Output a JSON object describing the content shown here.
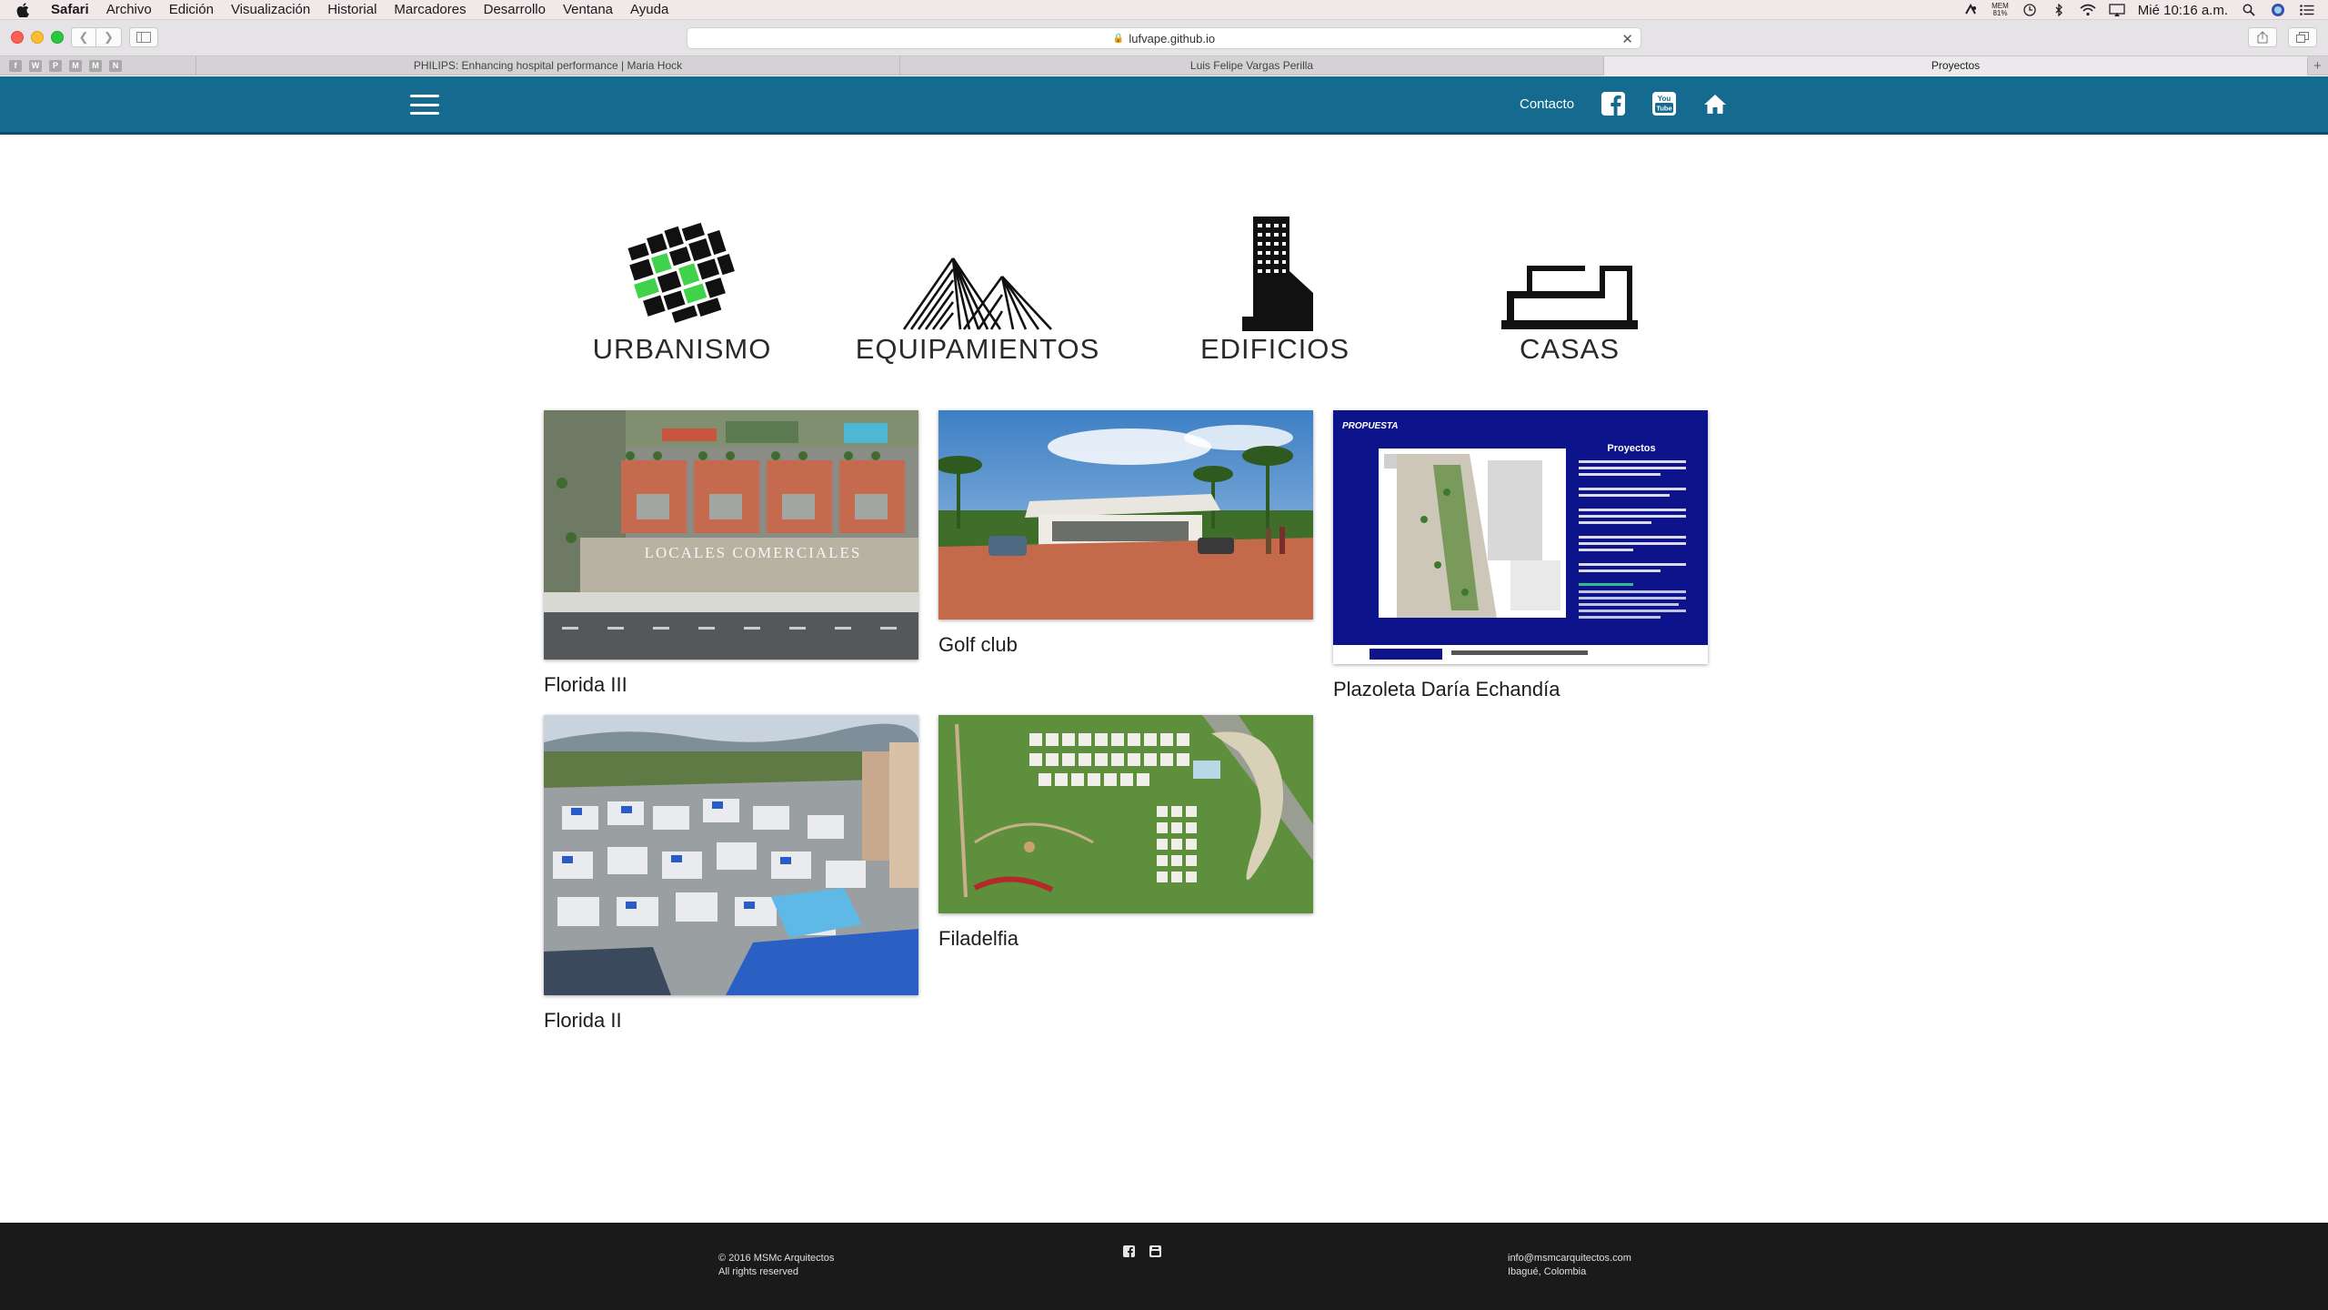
{
  "menubar": {
    "app": "Safari",
    "items": [
      "Archivo",
      "Edición",
      "Visualización",
      "Historial",
      "Marcadores",
      "Desarrollo",
      "Ventana",
      "Ayuda"
    ],
    "battery_label": "MEM",
    "battery_value": "81%",
    "clock": "Mié 10:16 a.m."
  },
  "browser": {
    "url": "lufvape.github.io",
    "pinned_tabs": [
      "f",
      "W",
      "P",
      "M",
      "M",
      "N"
    ],
    "tabs": [
      {
        "title": "PHILIPS: Enhancing hospital performance | Maria Hock"
      },
      {
        "title": "Luis Felipe Vargas Perilla"
      },
      {
        "title": "Proyectos"
      }
    ],
    "new_tab": "+"
  },
  "header": {
    "contact": "Contacto",
    "icons": [
      "facebook-icon",
      "youtube-icon",
      "home-icon"
    ],
    "accent_color": "#156b8f"
  },
  "categories": [
    {
      "label": "URBANISMO"
    },
    {
      "label": "EQUIPAMIENTOS"
    },
    {
      "label": "EDIFICIOS"
    },
    {
      "label": "CASAS"
    }
  ],
  "projects": [
    {
      "title": "Florida III",
      "thumb_text": "LOCALES COMERCIALES"
    },
    {
      "title": "Golf club"
    },
    {
      "title": "Plazoleta Daría Echandía",
      "thumb_heading": "PROPUESTA",
      "thumb_subtitle": "Proyectos"
    },
    {
      "title": "Florida II"
    },
    {
      "title": "Filadelfia"
    }
  ],
  "footer": {
    "copyright": "© 2016 MSMc Arquitectos",
    "rights": "All rights reserved",
    "email": "info@msmcarquitectos.com",
    "location": "Ibagué, Colombia"
  }
}
